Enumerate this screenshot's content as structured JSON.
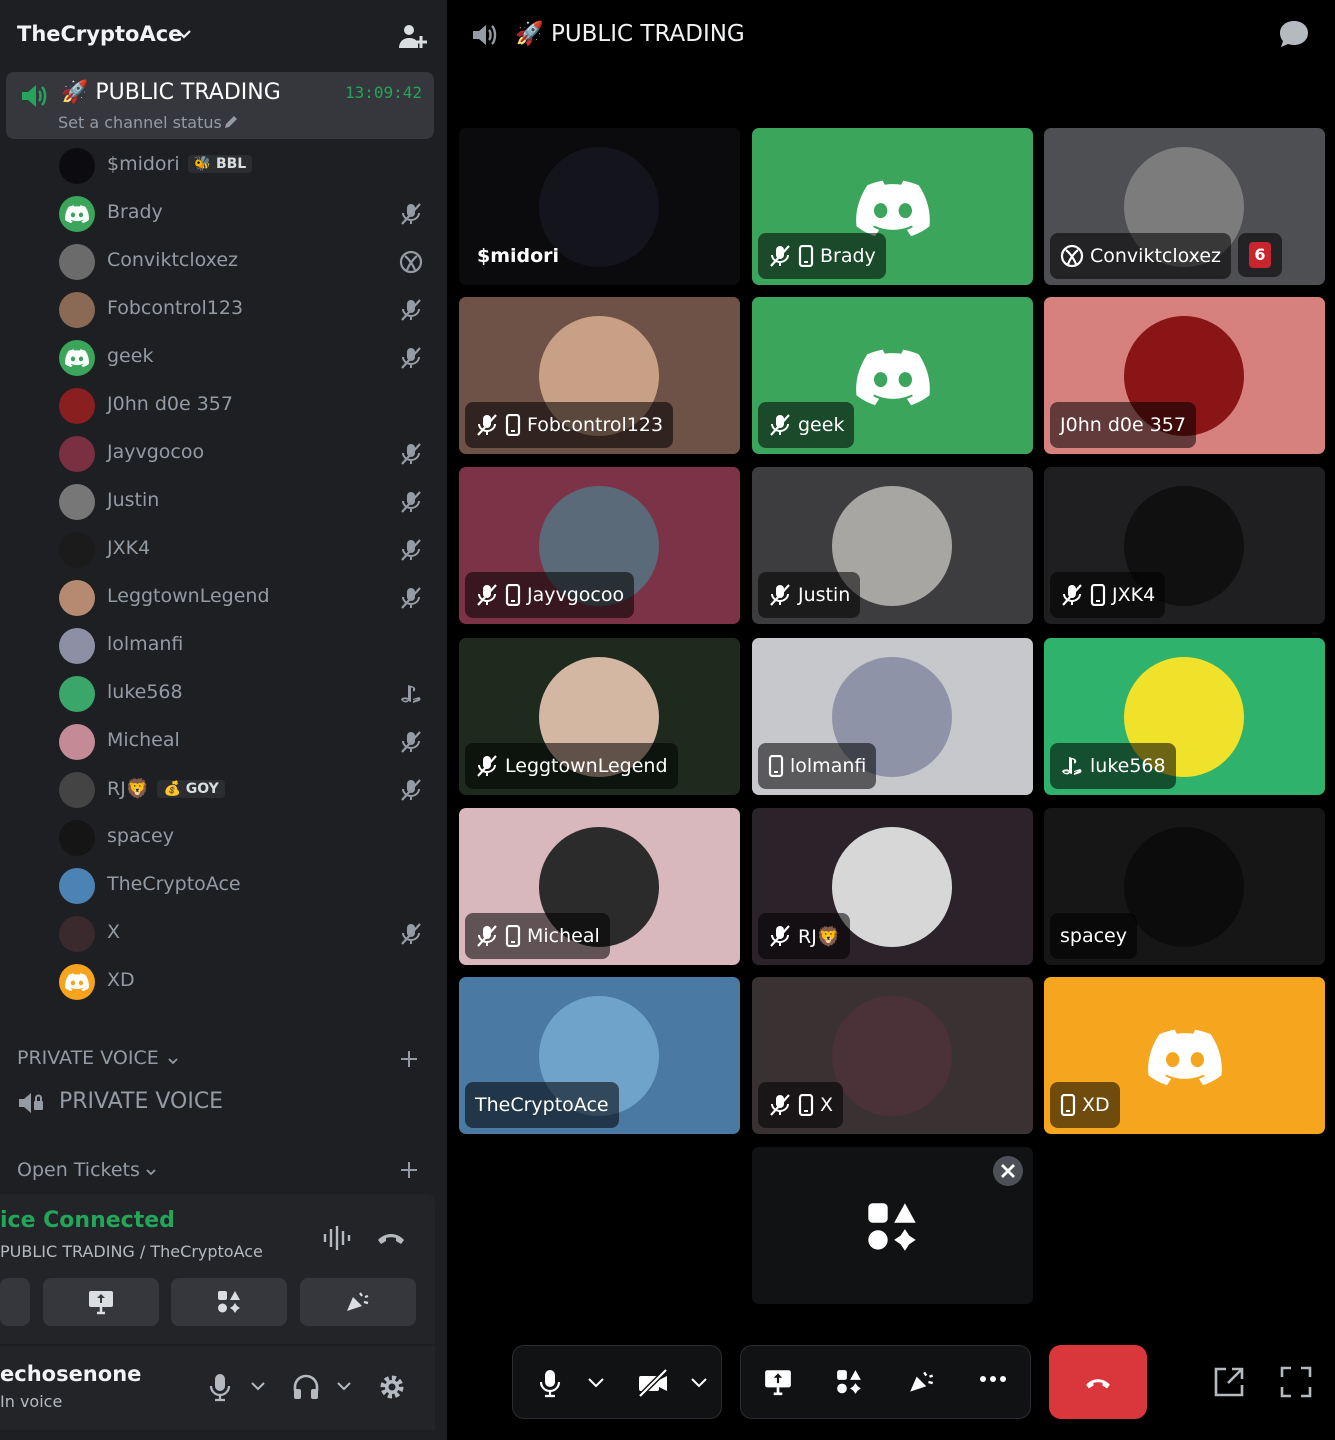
{
  "server": {
    "name": "TheCryptoAce"
  },
  "active_channel": {
    "name": "🚀 PUBLIC TRADING",
    "time": "13:09:42",
    "status_placeholder": "Set a channel status"
  },
  "members": [
    {
      "name": "$midori",
      "tag": "🐝 BBL",
      "icon": "none",
      "avatar_color": "#0b0b10"
    },
    {
      "name": "Brady",
      "icon": "mute-icon",
      "avatar_color": "#3ba55c"
    },
    {
      "name": "Conviktcloxez",
      "icon": "xbox-icon",
      "avatar_color": "#6b6b6b"
    },
    {
      "name": "Fobcontrol123",
      "icon": "mute-icon",
      "avatar_color": "#8a6a55"
    },
    {
      "name": "geek",
      "icon": "mute-icon",
      "avatar_color": "#3ba55c"
    },
    {
      "name": "J0hn d0e 357",
      "icon": "none",
      "avatar_color": "#8a1f1f"
    },
    {
      "name": "Jayvgocoo",
      "icon": "mute-icon",
      "avatar_color": "#7a3040"
    },
    {
      "name": "Justin",
      "icon": "mute-icon",
      "avatar_color": "#777"
    },
    {
      "name": "JXK4",
      "icon": "mute-icon",
      "avatar_color": "#1b1b1b"
    },
    {
      "name": "LeggtownLegend",
      "icon": "mute-icon",
      "avatar_color": "#b58a70"
    },
    {
      "name": "lolmanfi",
      "icon": "none",
      "avatar_color": "#8d90a5"
    },
    {
      "name": "luke568",
      "icon": "playstation-icon",
      "avatar_color": "#3aa66a"
    },
    {
      "name": "Micheal",
      "icon": "mute-icon",
      "avatar_color": "#c48a96"
    },
    {
      "name": "RJ🦁",
      "tag": "💰 GOY",
      "icon": "mute-icon",
      "avatar_color": "#444"
    },
    {
      "name": "spacey",
      "icon": "none",
      "avatar_color": "#151515"
    },
    {
      "name": "TheCryptoAce",
      "icon": "none",
      "avatar_color": "#4c83b5"
    },
    {
      "name": "X",
      "icon": "mute-icon",
      "avatar_color": "#3a2a2e"
    },
    {
      "name": "XD",
      "icon": "none",
      "avatar_color": "#f6a31d"
    }
  ],
  "categories": {
    "private_voice": "PRIVATE VOICE",
    "private_voice_channel": "PRIVATE VOICE",
    "open_tickets": "Open Tickets"
  },
  "voice_status": {
    "status": "ice Connected",
    "channel": "PUBLIC TRADING / TheCryptoAce"
  },
  "user": {
    "name": "echosenone",
    "status": "In voice"
  },
  "main": {
    "title": "🚀 PUBLIC TRADING"
  },
  "tiles": [
    {
      "name": "$midori",
      "bg": "#0b0b0e",
      "avatar": "#14141c",
      "style": "plain",
      "muted": false,
      "mobile": false
    },
    {
      "name": "Brady",
      "bg": "#3ba55c",
      "avatar": "discord",
      "muted": true,
      "mobile": true
    },
    {
      "name": "Conviktcloxez",
      "bg": "#4e4f53",
      "avatar": "#7c7c7c",
      "muted": false,
      "mobile": false,
      "platform": "xbox",
      "badge": "6"
    },
    {
      "name": "Fobcontrol123",
      "bg": "#6e5147",
      "avatar": "#c8a086",
      "muted": true,
      "mobile": true
    },
    {
      "name": "geek",
      "bg": "#3ba55c",
      "avatar": "discord",
      "muted": true,
      "mobile": false
    },
    {
      "name": "J0hn d0e 357",
      "bg": "#d7817f",
      "avatar": "#8a1516",
      "muted": false,
      "mobile": false
    },
    {
      "name": "Jayvgocoo",
      "bg": "#7c3347",
      "avatar": "#5a6a78",
      "muted": true,
      "mobile": true
    },
    {
      "name": "Justin",
      "bg": "#3d3d3f",
      "avatar": "#a8a6a2",
      "muted": true,
      "mobile": false
    },
    {
      "name": "JXK4",
      "bg": "#1f1f21",
      "avatar": "#101010",
      "muted": true,
      "mobile": true
    },
    {
      "name": "LeggtownLegend",
      "bg": "#1e2a1e",
      "avatar": "#d4b7a2",
      "muted": true,
      "mobile": false
    },
    {
      "name": "lolmanfi",
      "bg": "#c7c8cc",
      "avatar": "#8f93a8",
      "muted": false,
      "mobile": true
    },
    {
      "name": "luke568",
      "bg": "#2eb26c",
      "avatar": "#f0e12a",
      "muted": false,
      "mobile": false,
      "platform": "playstation"
    },
    {
      "name": "Micheal",
      "bg": "#d8b7bd",
      "avatar": "#2b2b2b",
      "muted": true,
      "mobile": true
    },
    {
      "name": "RJ🦁",
      "bg": "#2b2329",
      "avatar": "#d7d7d7",
      "muted": true,
      "mobile": false
    },
    {
      "name": "spacey",
      "bg": "#161617",
      "avatar": "#0c0c0c",
      "muted": false,
      "mobile": false
    },
    {
      "name": "TheCryptoAce",
      "bg": "#4a7aa3",
      "avatar": "#6fa3c9",
      "muted": false,
      "mobile": false
    },
    {
      "name": "X",
      "bg": "#3a3133",
      "avatar": "#4a3238",
      "muted": true,
      "mobile": true
    },
    {
      "name": "XD",
      "bg": "#f6a61e",
      "avatar": "discord",
      "muted": false,
      "mobile": true
    }
  ],
  "colors": {
    "sidebar_bg": "#1e1f22",
    "active_channel_bg": "#35373c",
    "connected_green": "#23a55a",
    "end_call_red": "#da373c"
  }
}
